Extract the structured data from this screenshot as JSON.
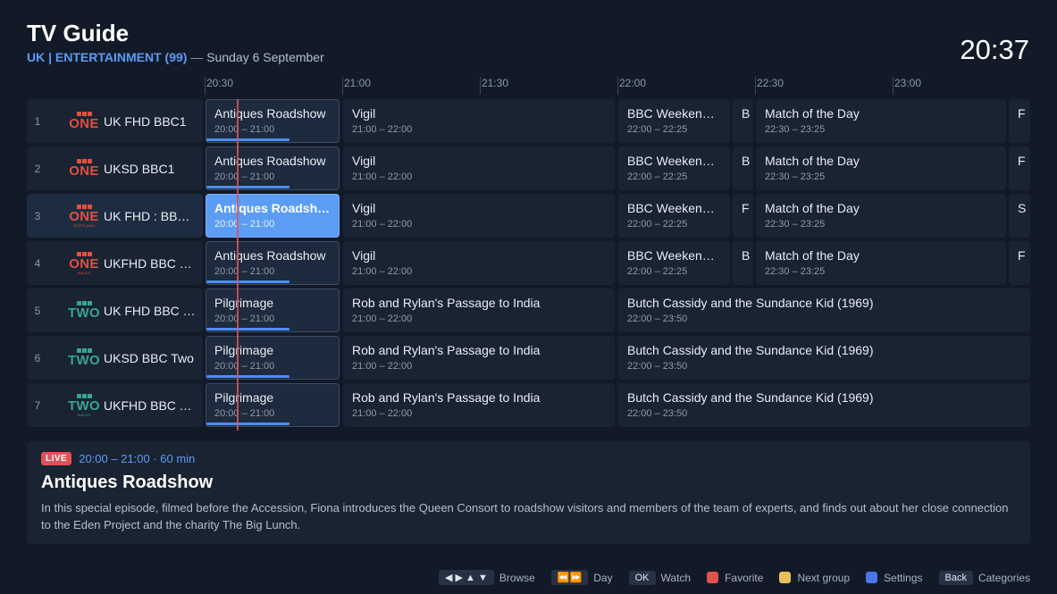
{
  "header": {
    "title": "TV Guide",
    "category": "UK | ENTERTAINMENT (99)",
    "separator": "—",
    "date": "Sunday 6 September",
    "clock": "20:37"
  },
  "timeline": [
    "20:30",
    "21:00",
    "21:30",
    "22:00",
    "22:30",
    "23:00"
  ],
  "channels": [
    {
      "num": "1",
      "name": "UK FHD BBC1",
      "logo": {
        "word": "ONE",
        "region": ""
      },
      "programs": [
        {
          "title": "Antiques Roadshow",
          "time": "20:00 – 21:00"
        },
        {
          "title": "Vigil",
          "time": "21:00 – 22:00"
        },
        {
          "title": "BBC Weekend News",
          "time": "22:00 – 22:25"
        },
        {
          "title": "B",
          "time": ""
        },
        {
          "title": "Match of the Day",
          "time": "22:30 – 23:25"
        },
        {
          "title": "F",
          "time": ""
        }
      ]
    },
    {
      "num": "2",
      "name": "UKSD BBC1",
      "logo": {
        "word": "ONE",
        "region": ""
      },
      "programs": [
        {
          "title": "Antiques Roadshow",
          "time": "20:00 – 21:00"
        },
        {
          "title": "Vigil",
          "time": "21:00 – 22:00"
        },
        {
          "title": "BBC Weekend News",
          "time": "22:00 – 22:25"
        },
        {
          "title": "B",
          "time": ""
        },
        {
          "title": "Match of the Day",
          "time": "22:30 – 23:25"
        },
        {
          "title": "F",
          "time": ""
        }
      ]
    },
    {
      "num": "3",
      "name": "UK FHD : BBC ONE Scotland",
      "logo": {
        "word": "ONE",
        "region": "SCOTLAND"
      },
      "programs": [
        {
          "title": "Antiques Roadshow",
          "time": "20:00 – 21:00"
        },
        {
          "title": "Vigil",
          "time": "21:00 – 22:00"
        },
        {
          "title": "BBC Weekend News",
          "time": "22:00 – 22:25"
        },
        {
          "title": "F",
          "time": ""
        },
        {
          "title": "Match of the Day",
          "time": "22:30 – 23:25"
        },
        {
          "title": "S",
          "time": ""
        }
      ]
    },
    {
      "num": "4",
      "name": "UKFHD BBC ONE Wales",
      "logo": {
        "word": "ONE",
        "region": "WALES"
      },
      "programs": [
        {
          "title": "Antiques Roadshow",
          "time": "20:00 – 21:00"
        },
        {
          "title": "Vigil",
          "time": "21:00 – 22:00"
        },
        {
          "title": "BBC Weekend News",
          "time": "22:00 – 22:25"
        },
        {
          "title": "B",
          "time": ""
        },
        {
          "title": "Match of the Day",
          "time": "22:30 – 23:25"
        },
        {
          "title": "F",
          "time": ""
        }
      ]
    },
    {
      "num": "5",
      "name": "UK FHD BBC TWO",
      "logo": {
        "word": "TWO",
        "region": ""
      },
      "programs": [
        {
          "title": "Pilgrimage",
          "time": "20:00 – 21:00"
        },
        {
          "title": "Rob and Rylan's Passage to India",
          "time": "21:00 – 22:00"
        },
        {
          "title": "Butch Cassidy and the Sundance Kid (1969)",
          "time": "22:00 – 23:50"
        }
      ]
    },
    {
      "num": "6",
      "name": "UKSD BBC Two",
      "logo": {
        "word": "TWO",
        "region": ""
      },
      "programs": [
        {
          "title": "Pilgrimage",
          "time": "20:00 – 21:00"
        },
        {
          "title": "Rob and Rylan's Passage to India",
          "time": "21:00 – 22:00"
        },
        {
          "title": "Butch Cassidy and the Sundance Kid (1969)",
          "time": "22:00 – 23:50"
        }
      ]
    },
    {
      "num": "7",
      "name": "UKFHD BBC TWO Wales",
      "logo": {
        "word": "TWO",
        "region": "WALES"
      },
      "programs": [
        {
          "title": "Pilgrimage",
          "time": "20:00 – 21:00"
        },
        {
          "title": "Rob and Rylan's Passage to India",
          "time": "21:00 – 22:00"
        },
        {
          "title": "Butch Cassidy and the Sundance Kid (1969)",
          "time": "22:00 – 23:50"
        }
      ]
    }
  ],
  "now_progress": 0.62,
  "details": {
    "badge": "LIVE",
    "time": "20:00 – 21:00 · 60 min",
    "title": "Antiques Roadshow",
    "description": "In this special episode, filmed before the Accession, Fiona introduces the Queen Consort to roadshow visitors and members of the team of experts, and finds out about her close connection to the Eden Project and the charity The Big Lunch."
  },
  "footer": {
    "browse_key": "◀ ▶ ▲ ▼",
    "browse": "Browse",
    "day_key": "⏪⏩",
    "day": "Day",
    "ok_key": "OK",
    "watch": "Watch",
    "favorite": "Favorite",
    "next_group": "Next group",
    "settings": "Settings",
    "back_key": "Back",
    "categories": "Categories",
    "colors": {
      "red": "#e0534a",
      "yellow": "#e6c15a",
      "blue": "#4a76e8"
    }
  }
}
